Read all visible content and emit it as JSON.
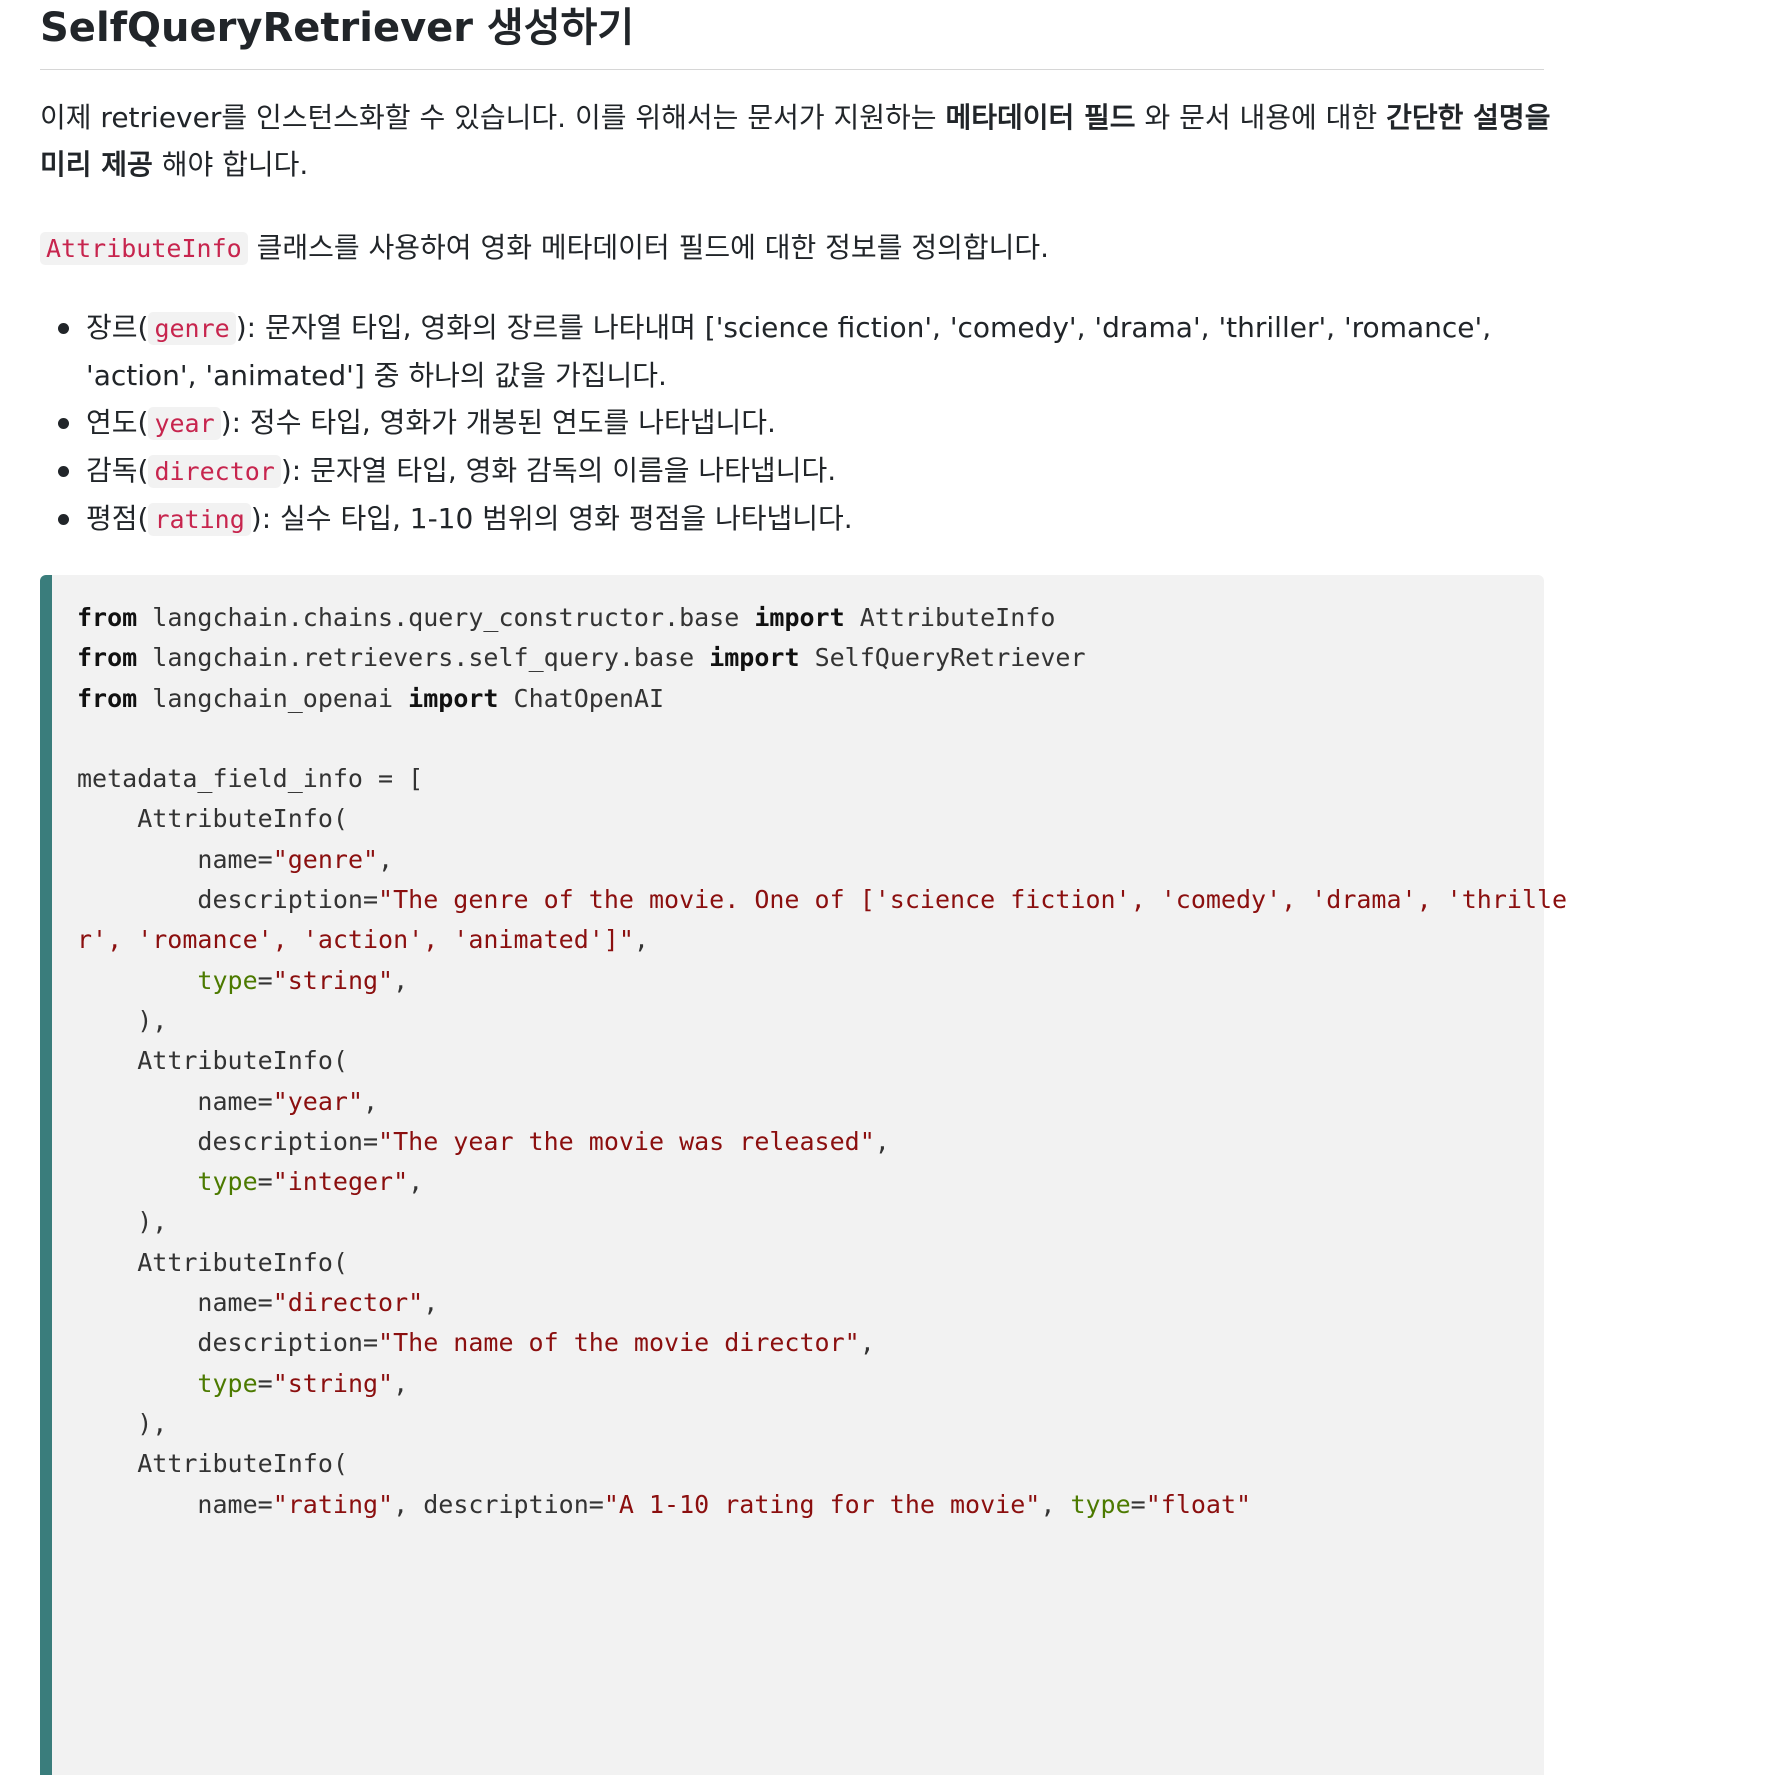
{
  "heading": {
    "title": "SelfQueryRetriever 생성하기"
  },
  "intro": {
    "p1_a": "이제 retriever를 인스턴스화할 수 있습니다. 이를 위해서는 문서가 지원하는 ",
    "p1_b": "메타데이터 필드",
    "p1_c": " 와 문서 내용에 대한 ",
    "p1_d": "간단한 설명을",
    "p1_e": "미리 제공",
    "p1_f": " 해야 합니다.",
    "p2_code": "AttributeInfo",
    "p2_text": " 클래스를 사용하여 영화 메타데이터 필드에 대한 정보를 정의합니다."
  },
  "bullets": [
    {
      "pre": "장르(",
      "code": "genre",
      "post": "): 문자열 타입, 영화의 장르를 나타내며 ['science fiction', 'comedy', 'drama', 'thriller', 'romance',",
      "cont": "'action', 'animated'] 중 하나의 값을 가집니다."
    },
    {
      "pre": "연도(",
      "code": "year",
      "post": "): 정수 타입, 영화가 개봉된 연도를 나타냅니다."
    },
    {
      "pre": "감독(",
      "code": "director",
      "post": "): 문자열 타입, 영화 감독의 이름을 나타냅니다."
    },
    {
      "pre": "평점(",
      "code": "rating",
      "post": "): 실수 타입, 1-10 범위의 영화 평점을 나타냅니다."
    }
  ],
  "code": {
    "kw_from": "from",
    "kw_import": "import",
    "mod1": "langchain.chains.query_constructor.base",
    "cls1": "AttributeInfo",
    "mod2": "langchain.retrievers.self_query.base",
    "cls2": "SelfQueryRetriever",
    "mod3": "langchain_openai",
    "cls3": "ChatOpenAI",
    "assign": "metadata_field_info = [",
    "ctor": "AttributeInfo(",
    "close": "),",
    "name_eq": "name=",
    "desc_eq": "description=",
    "type_eq": "type",
    "eq": "=",
    "comma": ",",
    "s_genre": "\"genre\"",
    "s_genre_desc_1": "\"The genre of the movie. One of ['science fiction', 'comedy', 'drama', 'thrille",
    "s_genre_desc_2": "r', 'romance', 'action', 'animated']\"",
    "s_string": "\"string\"",
    "s_year": "\"year\"",
    "s_year_desc": "\"The year the movie was released\"",
    "s_integer": "\"integer\"",
    "s_director": "\"director\"",
    "s_director_desc": "\"The name of the movie director\"",
    "s_rating": "\"rating\"",
    "rating_mid": ", description=",
    "s_rating_desc": "\"A 1-10 rating for the movie\"",
    "rating_tail": ", ",
    "s_float": "\"float\""
  }
}
